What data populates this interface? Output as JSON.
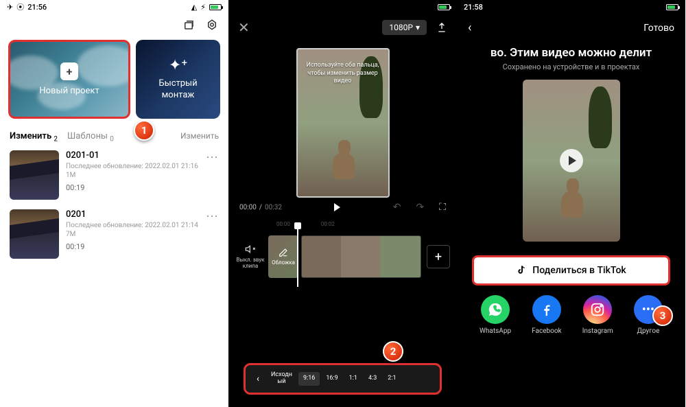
{
  "statusbar": {
    "time": "21:56",
    "time3": "21:58"
  },
  "panel1": {
    "new_project": "Новый проект",
    "quick_edit": "Быстрый\nмонтаж",
    "tabs": {
      "edit": "Изменить",
      "edit_count": "2",
      "templates": "Шаблоны",
      "templates_count": "0",
      "action": "Изменить"
    },
    "projects": [
      {
        "title": "0201-01",
        "meta": "Последнее обновление: 2022.02.01 21:16",
        "size": "1M",
        "duration": "00:19"
      },
      {
        "title": "0201",
        "meta": "Последнее обновление: 2022.02.01 21:14",
        "size": "7M",
        "duration": "00:19"
      }
    ]
  },
  "panel2": {
    "resolution": "1080P",
    "hint": "Используйте оба пальца, чтобы изменить размер видео",
    "time_current": "00:00",
    "time_total": "00:32",
    "ruler": [
      "00:00",
      "00:02"
    ],
    "mute": "Выкл. звук клипа",
    "cover": "Обложка",
    "aspect": {
      "original": "Исходн\nый",
      "items": [
        "9:16",
        "16:9",
        "1:1",
        "4:3",
        "2:1"
      ]
    }
  },
  "panel3": {
    "done": "Готово",
    "title": "во. Этим видео можно делит",
    "subtitle": "Сохранено на устройстве и в проектах",
    "share_tiktok": "Поделиться в TikTok",
    "share": [
      {
        "label": "WhatsApp"
      },
      {
        "label": "Facebook"
      },
      {
        "label": "Instagram"
      },
      {
        "label": "Другое"
      }
    ]
  },
  "badges": {
    "b1": "1",
    "b2": "2",
    "b3": "3"
  }
}
